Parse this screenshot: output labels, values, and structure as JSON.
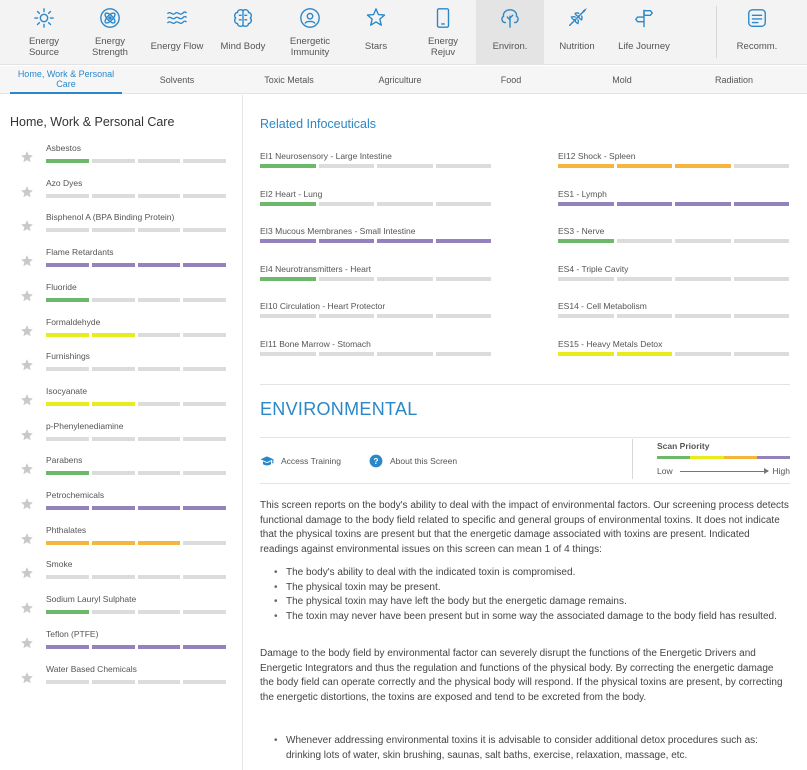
{
  "nav": [
    {
      "label": "Energy Source",
      "icon": "sun-icon"
    },
    {
      "label": "Energy Strength",
      "icon": "atom-icon"
    },
    {
      "label": "Energy Flow",
      "icon": "waves-icon"
    },
    {
      "label": "Mind Body",
      "icon": "brain-icon"
    },
    {
      "label": "Energetic Immunity",
      "icon": "shield-person-icon"
    },
    {
      "label": "Stars",
      "icon": "star-burst-icon"
    },
    {
      "label": "Energy Rejuv",
      "icon": "phone-icon"
    },
    {
      "label": "Environ.",
      "icon": "tree-icon"
    },
    {
      "label": "Nutrition",
      "icon": "wheat-icon"
    },
    {
      "label": "Life Journey",
      "icon": "signpost-icon"
    },
    {
      "label": "Recomm.",
      "icon": "checklist-icon"
    }
  ],
  "subtabs": [
    {
      "label": "Home, Work & Personal Care"
    },
    {
      "label": "Solvents"
    },
    {
      "label": "Toxic Metals"
    },
    {
      "label": "Agriculture"
    },
    {
      "label": "Food"
    },
    {
      "label": "Mold"
    },
    {
      "label": "Radiation"
    }
  ],
  "colors": {
    "accent": "#2a87c8",
    "green": "#6db86b",
    "yellow": "#e8ec1c",
    "orange": "#f5b63d",
    "purple": "#9382bc",
    "empty": "#dcdcdc"
  },
  "left": {
    "title": "Home, Work & Personal Care",
    "items": [
      {
        "label": "Asbestos",
        "level": 1,
        "color": "green"
      },
      {
        "label": "Azo Dyes",
        "level": 0,
        "color": "empty"
      },
      {
        "label": "Bisphenol A (BPA Binding Protein)",
        "level": 0,
        "color": "empty"
      },
      {
        "label": "Flame Retardants",
        "level": 4,
        "color": "purple"
      },
      {
        "label": "Fluoride",
        "level": 1,
        "color": "green"
      },
      {
        "label": "Formaldehyde",
        "level": 2,
        "color": "yellow"
      },
      {
        "label": "Furnishings",
        "level": 0,
        "color": "empty"
      },
      {
        "label": "Isocyanate",
        "level": 2,
        "color": "yellow"
      },
      {
        "label": "p-Phenylenediamine",
        "level": 0,
        "color": "empty"
      },
      {
        "label": "Parabens",
        "level": 1,
        "color": "green"
      },
      {
        "label": "Petrochemicals",
        "level": 4,
        "color": "purple"
      },
      {
        "label": "Phthalates",
        "level": 3,
        "color": "orange"
      },
      {
        "label": "Smoke",
        "level": 0,
        "color": "empty"
      },
      {
        "label": "Sodium Lauryl Sulphate",
        "level": 1,
        "color": "green"
      },
      {
        "label": "Teflon (PTFE)",
        "level": 4,
        "color": "purple"
      },
      {
        "label": "Water Based Chemicals",
        "level": 0,
        "color": "empty"
      }
    ]
  },
  "related": {
    "title": "Related Infoceuticals",
    "items": [
      {
        "label": "EI1 Neurosensory - Large Intestine",
        "level": 1,
        "color": "green"
      },
      {
        "label": "EI12 Shock - Spleen",
        "level": 3,
        "color": "orange"
      },
      {
        "label": "EI2 Heart - Lung",
        "level": 1,
        "color": "green"
      },
      {
        "label": "ES1 - Lymph",
        "level": 4,
        "color": "purple"
      },
      {
        "label": "EI3 Mucous Membranes - Small Intestine",
        "level": 4,
        "color": "purple"
      },
      {
        "label": "ES3 - Nerve",
        "level": 1,
        "color": "green"
      },
      {
        "label": "EI4 Neurotransmitters - Heart",
        "level": 1,
        "color": "green"
      },
      {
        "label": "ES4 - Triple Cavity",
        "level": 0,
        "color": "empty"
      },
      {
        "label": "EI10 Circulation - Heart Protector",
        "level": 0,
        "color": "empty"
      },
      {
        "label": "ES14 - Cell Metabolism",
        "level": 0,
        "color": "empty"
      },
      {
        "label": "EI11 Bone Marrow - Stomach",
        "level": 0,
        "color": "empty"
      },
      {
        "label": "ES15 - Heavy Metals Detox",
        "level": 2,
        "color": "yellow"
      }
    ]
  },
  "env": {
    "title": "ENVIRONMENTAL",
    "access_training": "Access Training",
    "about_screen": "About this Screen",
    "scan_priority": "Scan Priority",
    "low": "Low",
    "high": "High",
    "scan_colors": [
      "green",
      "yellow",
      "orange",
      "purple"
    ],
    "para1": "This screen reports on the body's ability to deal with the impact of environmental factors. Our screening process detects functional damage to the body field related to specific and general groups of environmental toxins. It does not indicate that the physical toxins are present but that the energetic damage associated with toxins are present. Indicated readings against environmental issues on this screen can mean 1 of 4 things:",
    "bullets1": [
      "The body's ability to deal with the indicated toxin is compromised.",
      "The physical toxin may be present.",
      "The physical toxin may have left the body but the energetic damage remains.",
      "The toxin may never have been present but in some way the associated damage to the body field has resulted."
    ],
    "para2": "Damage to the body field by environmental factor can severely disrupt the functions of the Energetic Drivers and Energetic Integrators and thus the regulation and functions of the physical body. By correcting the energetic damage the body field can operate correctly and the physical body will respond. If the physical toxins are present, by correcting the energetic distortions, the toxins are exposed and tend to be excreted from the body.",
    "bullets2": [
      "Whenever addressing environmental toxins it is advisable to consider additional detox procedures such as: drinking lots of water, skin brushing, saunas, salt baths, exercise, relaxation, massage, etc."
    ]
  }
}
